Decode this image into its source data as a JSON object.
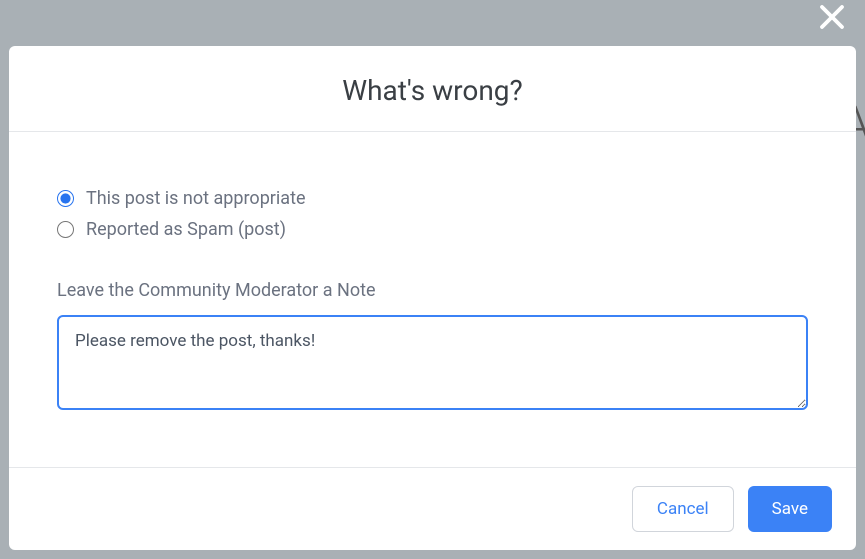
{
  "modal": {
    "title": "What's wrong?",
    "options": [
      {
        "label": "This post is not appropriate",
        "selected": true
      },
      {
        "label": "Reported as Spam (post)",
        "selected": false
      }
    ],
    "note_label": "Leave the Community Moderator a Note",
    "note_value": "Please remove the post, thanks!",
    "cancel_label": "Cancel",
    "save_label": "Save"
  }
}
